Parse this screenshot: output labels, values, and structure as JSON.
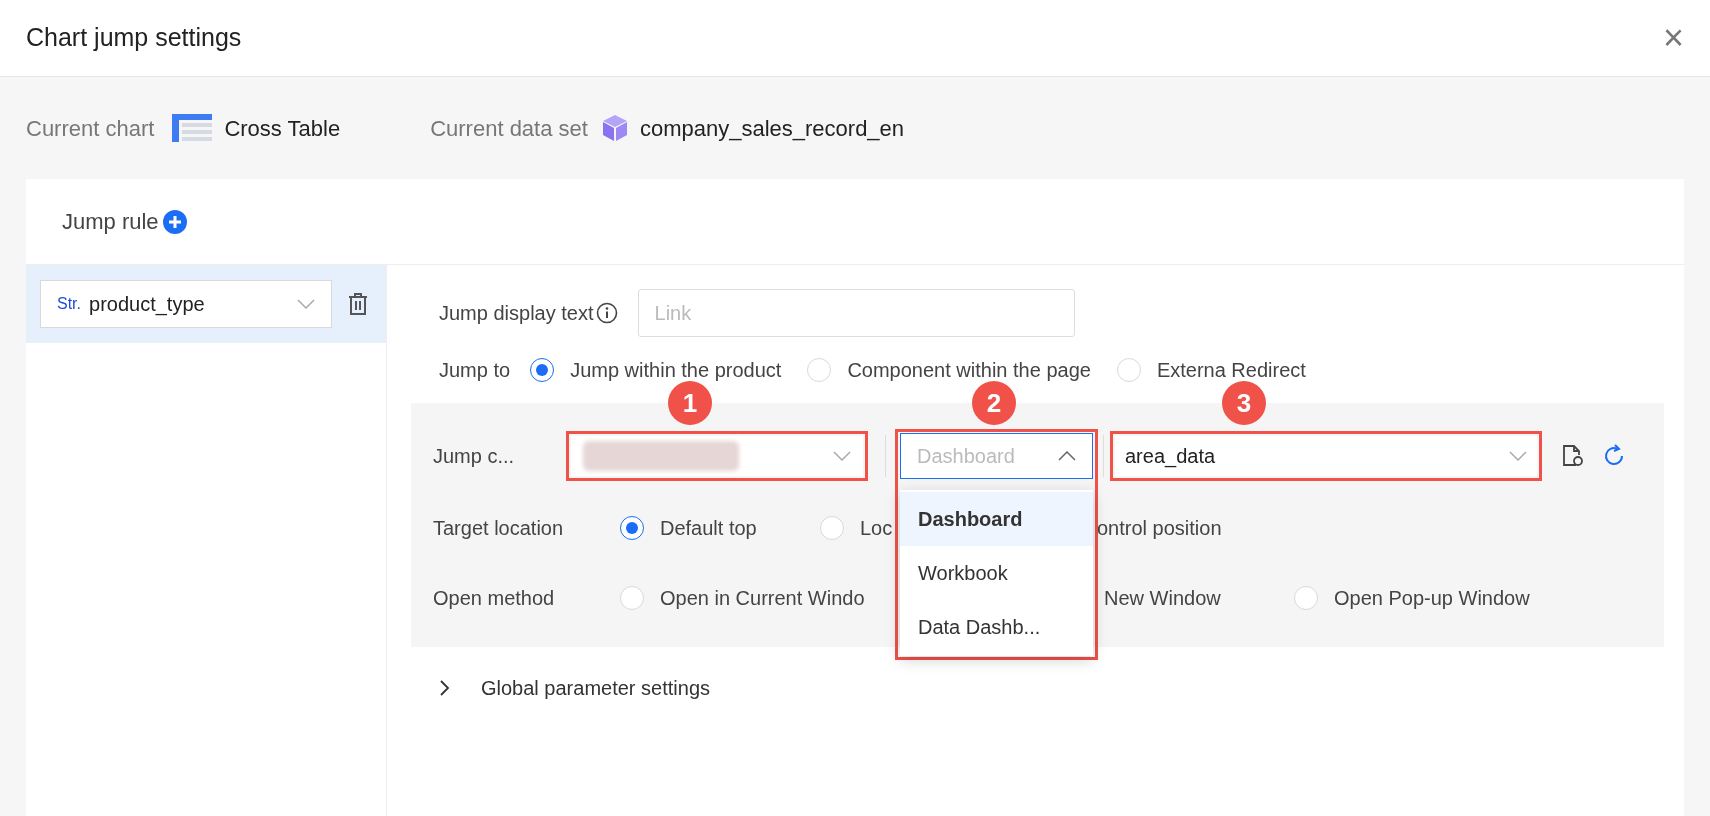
{
  "dialog": {
    "title": "Chart jump settings",
    "close": "×"
  },
  "info": {
    "chart_label": "Current chart",
    "chart_value": "Cross Table",
    "dataset_label": "Current data set",
    "dataset_value": "company_sales_record_en"
  },
  "jump_rule": {
    "title": "Jump rule"
  },
  "rules": [
    {
      "type_tag": "Str.",
      "field": "product_type",
      "selected": true
    }
  ],
  "display_text": {
    "label": "Jump display text",
    "placeholder": "Link"
  },
  "jump_to": {
    "label": "Jump to",
    "options": [
      {
        "label": "Jump within the product",
        "selected": true
      },
      {
        "label": "Component within the page",
        "selected": false
      },
      {
        "label": "Externa Redirect",
        "selected": false
      }
    ]
  },
  "jump_content": {
    "label": "Jump c...",
    "type_select": {
      "value": "Dashboard",
      "expanded": true
    },
    "target_select": {
      "value": "area_data"
    },
    "menu": [
      {
        "label": "Dashboard",
        "selected": true
      },
      {
        "label": "Workbook",
        "selected": false
      },
      {
        "label": "Data Dashb...",
        "selected": false
      }
    ]
  },
  "target_location": {
    "label": "Target location",
    "options": [
      {
        "kind": "radio",
        "label": "Default top",
        "selected": true
      },
      {
        "kind": "radio",
        "label": "Loc",
        "selected": false
      },
      {
        "kind": "fragment",
        "label": "ontrol position"
      }
    ]
  },
  "open_method": {
    "label": "Open method",
    "options": [
      {
        "kind": "radio",
        "label": "Open in Current Windo",
        "selected": false
      },
      {
        "kind": "fragment",
        "label": "New Window"
      },
      {
        "kind": "radio",
        "label": "Open Pop-up Window",
        "selected": false
      }
    ]
  },
  "global_params": {
    "label": "Global parameter settings",
    "expanded": false
  },
  "badges": [
    "1",
    "2",
    "3"
  ]
}
